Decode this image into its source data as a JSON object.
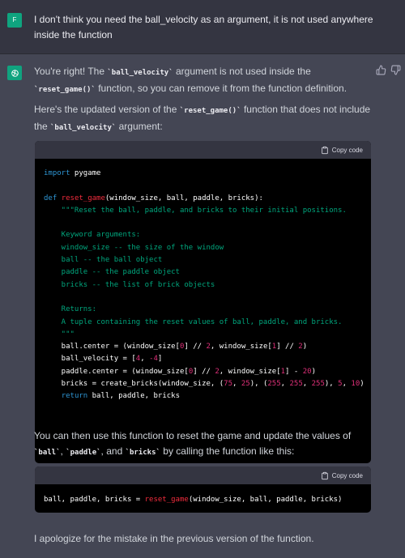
{
  "user_message": {
    "avatar_initial": "F",
    "text": "I don't think you need the ball_velocity as an argument, it is not used anywhere inside the function"
  },
  "assistant": {
    "para1": {
      "t1": "You're right! The ",
      "c1": "`ball_velocity`",
      "t2": " argument is not used inside the ",
      "c2": "`reset_game()`",
      "t3": " function, so you can remove it from the function definition."
    },
    "para2": {
      "t1": "Here's the updated version of the ",
      "c1": "`reset_game()`",
      "t2": " function that does not include the ",
      "c2": "`ball_velocity`",
      "t3": " argument:"
    },
    "para3": {
      "t1": "You can then use this function to reset the game and update the values of ",
      "c1": "`ball`",
      "t2": ", ",
      "c2": "`paddle`",
      "t3": ", and ",
      "c3": "`bricks`",
      "t4": " by calling the function like this:"
    },
    "para4": "I apologize for the mistake in the previous version of the function."
  },
  "code_block_1": {
    "copy_label": "Copy code",
    "lines": [
      [
        {
          "k": "kw",
          "t": "import"
        },
        {
          "t": " pygame"
        }
      ],
      [],
      [
        {
          "k": "kw",
          "t": "def"
        },
        {
          "t": " "
        },
        {
          "k": "fn",
          "t": "reset_game"
        },
        {
          "t": "(window_size, ball, paddle, bricks):"
        }
      ],
      [
        {
          "k": "str",
          "t": "    \"\"\"Reset the ball, paddle, and bricks to their initial positions."
        }
      ],
      [],
      [
        {
          "k": "str",
          "t": "    Keyword arguments:"
        }
      ],
      [
        {
          "k": "str",
          "t": "    window_size -- the size of the window"
        }
      ],
      [
        {
          "k": "str",
          "t": "    ball -- the ball object"
        }
      ],
      [
        {
          "k": "str",
          "t": "    paddle -- the paddle object"
        }
      ],
      [
        {
          "k": "str",
          "t": "    bricks -- the list of brick objects"
        }
      ],
      [],
      [
        {
          "k": "str",
          "t": "    Returns:"
        }
      ],
      [
        {
          "k": "str",
          "t": "    A tuple containing the reset values of ball, paddle, and bricks."
        }
      ],
      [
        {
          "k": "str",
          "t": "    \"\"\""
        }
      ],
      [
        {
          "t": "    ball.center = (window_size["
        },
        {
          "k": "num",
          "t": "0"
        },
        {
          "t": "] // "
        },
        {
          "k": "num",
          "t": "2"
        },
        {
          "t": ", window_size["
        },
        {
          "k": "num",
          "t": "1"
        },
        {
          "t": "] // "
        },
        {
          "k": "num",
          "t": "2"
        },
        {
          "t": ")"
        }
      ],
      [
        {
          "t": "    ball_velocity = ["
        },
        {
          "k": "num",
          "t": "4"
        },
        {
          "t": ", "
        },
        {
          "k": "num",
          "t": "-4"
        },
        {
          "t": "]"
        }
      ],
      [
        {
          "t": "    paddle.center = (window_size["
        },
        {
          "k": "num",
          "t": "0"
        },
        {
          "t": "] // "
        },
        {
          "k": "num",
          "t": "2"
        },
        {
          "t": ", window_size["
        },
        {
          "k": "num",
          "t": "1"
        },
        {
          "t": "] - "
        },
        {
          "k": "num",
          "t": "20"
        },
        {
          "t": ")"
        }
      ],
      [
        {
          "t": "    bricks = create_bricks(window_size, ("
        },
        {
          "k": "num",
          "t": "75"
        },
        {
          "t": ", "
        },
        {
          "k": "num",
          "t": "25"
        },
        {
          "t": "), ("
        },
        {
          "k": "num",
          "t": "255"
        },
        {
          "t": ", "
        },
        {
          "k": "num",
          "t": "255"
        },
        {
          "t": ", "
        },
        {
          "k": "num",
          "t": "255"
        },
        {
          "t": "), "
        },
        {
          "k": "num",
          "t": "5"
        },
        {
          "t": ", "
        },
        {
          "k": "num",
          "t": "10"
        },
        {
          "t": ")"
        }
      ],
      [
        {
          "t": "    "
        },
        {
          "k": "kw",
          "t": "return"
        },
        {
          "t": " ball, paddle, bricks"
        }
      ]
    ]
  },
  "code_block_2": {
    "copy_label": "Copy code",
    "lines": [
      [
        {
          "t": "ball, paddle, bricks = "
        },
        {
          "k": "fn",
          "t": "reset_game"
        },
        {
          "t": "(window_size, ball, paddle, bricks)"
        }
      ]
    ]
  },
  "icons": {
    "assistant_avatar": "openai-logo-icon",
    "thumbs_up": "thumbs-up-icon",
    "thumbs_down": "thumbs-down-icon",
    "copy": "clipboard-icon"
  },
  "colors": {
    "background": "#343541",
    "assistant_background": "#444654",
    "avatar_green": "#10a37f",
    "code_background": "#000000",
    "keyword": "#2e95d3",
    "function": "#f22c3d",
    "string": "#00a67d",
    "number": "#df3079"
  }
}
